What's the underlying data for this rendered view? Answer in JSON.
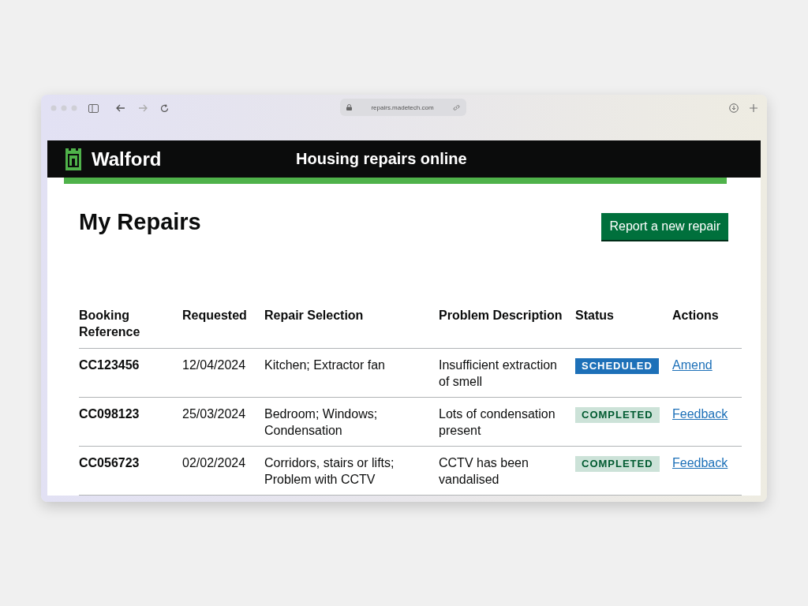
{
  "browser": {
    "address": "repairs.madetech.com"
  },
  "header": {
    "brand": "Walford",
    "service": "Housing repairs online"
  },
  "page": {
    "title": "My Repairs",
    "primary_button": "Report a new repair"
  },
  "table": {
    "columns": [
      "Booking Reference",
      "Requested",
      "Repair Selection",
      "Problem Description",
      "Status",
      "Actions"
    ],
    "rows": [
      {
        "reference": "CC123456",
        "requested": "12/04/2024",
        "selection": "Kitchen; Extractor fan",
        "problem": "Insufficient extraction of smell",
        "status": {
          "label": "SCHEDULED",
          "kind": "scheduled"
        },
        "action": "Amend"
      },
      {
        "reference": "CC098123",
        "requested": "25/03/2024",
        "selection": "Bedroom; Windows; Condensation",
        "problem": "Lots of condensation present",
        "status": {
          "label": "COMPLETED",
          "kind": "completed"
        },
        "action": "Feedback"
      },
      {
        "reference": "CC056723",
        "requested": "02/02/2024",
        "selection": "Corridors, stairs or lifts; Problem with CCTV",
        "problem": "CCTV has been vandalised",
        "status": {
          "label": "COMPLETED",
          "kind": "completed"
        },
        "action": "Feedback"
      }
    ]
  }
}
